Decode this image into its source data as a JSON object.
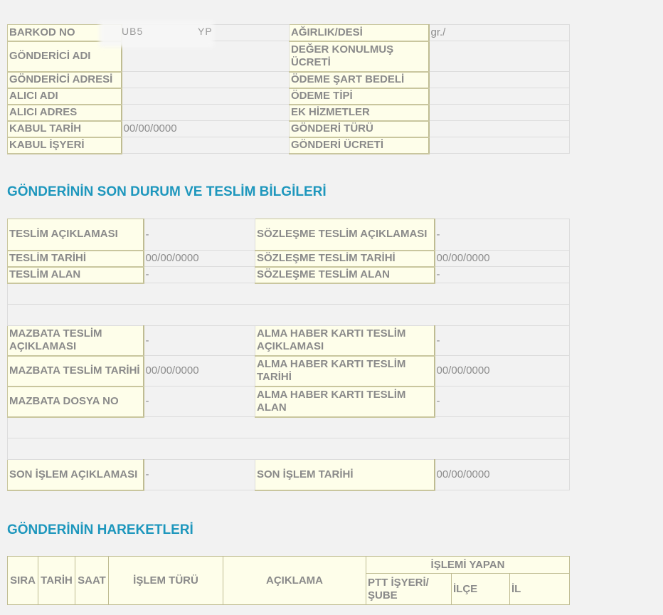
{
  "shipment": {
    "barcode_label": "BARKOD NO",
    "barcode_value": "UB5",
    "barcode_value_suffix": "YP",
    "weight_label": "AĞIRLIK/DESİ",
    "weight_value": "gr./",
    "sender_name_label": "GÖNDERİCİ ADI",
    "declared_value_label": "DEĞER KONULMUŞ ÜCRETİ",
    "sender_address_label": "GÖNDERİCİ ADRESİ",
    "payment_condition_label": "ÖDEME ŞART BEDELİ",
    "recipient_name_label": "ALICI ADI",
    "payment_type_label": "ÖDEME TİPİ",
    "recipient_address_label": "ALICI ADRES",
    "extra_services_label": "EK HİZMETLER",
    "accept_date_label": "KABUL TARİH",
    "accept_date_value": "00/00/0000",
    "shipment_type_label": "GÖNDERİ TÜRÜ",
    "accept_office_label": "KABUL İŞYERİ",
    "shipment_fee_label": "GÖNDERİ ÜCRETİ"
  },
  "delivery": {
    "title": "GÖNDERİNİN SON DURUM VE TESLİM BİLGİLERİ",
    "desc_label": "TESLİM AÇIKLAMASI",
    "desc_value": "-",
    "contract_desc_label": "SÖZLEŞME TESLİM AÇIKLAMASI",
    "contract_desc_value": "-",
    "date_label": "TESLİM TARİHİ",
    "date_value": "00/00/0000",
    "contract_date_label": "SÖZLEŞME TESLİM TARİHİ",
    "contract_date_value": "00/00/0000",
    "receiver_label": "TESLİM ALAN",
    "receiver_value": "-",
    "contract_receiver_label": "SÖZLEŞME TESLİM ALAN",
    "contract_receiver_value": "-",
    "mazbata_desc_label": "MAZBATA TESLİM AÇIKLAMASI",
    "mazbata_desc_value": "-",
    "ahk_desc_label": "ALMA HABER KARTI TESLİM AÇIKLAMASI",
    "ahk_desc_value": "-",
    "mazbata_date_label": "MAZBATA TESLİM TARİHİ",
    "mazbata_date_value": "00/00/0000",
    "ahk_date_label": "ALMA HABER KARTI TESLİM TARİHİ",
    "ahk_date_value": "00/00/0000",
    "mazbata_file_label": "MAZBATA DOSYA NO",
    "mazbata_file_value": "-",
    "ahk_receiver_label": "ALMA HABER KARTI TESLİM ALAN",
    "ahk_receiver_value": "-",
    "last_op_desc_label": "SON İŞLEM AÇIKLAMASI",
    "last_op_desc_value": "-",
    "last_op_date_label": "SON İŞLEM TARİHİ",
    "last_op_date_value": "00/00/0000"
  },
  "movements": {
    "title": "GÖNDERİNİN HAREKETLERİ",
    "headers": {
      "sira": "SIRA",
      "tarih": "TARİH",
      "saat": "SAAT",
      "islem_turu": "İŞLEM TÜRÜ",
      "aciklama": "AÇIKLAMA",
      "islemi_yapan": "İŞLEMİ YAPAN",
      "ptt_isyeri": "PTT İŞYERİ/ ŞUBE",
      "ilce": "İLÇE",
      "il": "İL"
    }
  }
}
